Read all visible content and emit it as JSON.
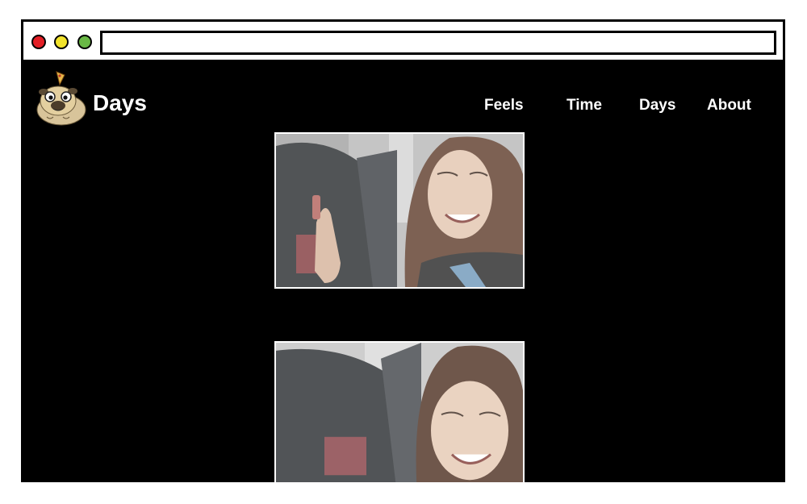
{
  "browser": {
    "url": "",
    "window_controls": [
      "close",
      "minimize",
      "maximize"
    ],
    "colors": {
      "close": "#e21f26",
      "minimize": "#f2e32c",
      "maximize": "#69b845"
    }
  },
  "site": {
    "brand": "Days",
    "logo_icon": "pug-with-pizza-icon",
    "nav": [
      {
        "label": "Feels"
      },
      {
        "label": "Time"
      },
      {
        "label": "Days"
      },
      {
        "label": "About"
      }
    ]
  },
  "content": {
    "photos": [
      {
        "subject": "photo-smiling-in-car"
      },
      {
        "subject": "photo-laughing-in-car"
      }
    ]
  },
  "colors": {
    "background": "#000000",
    "text": "#ffffff"
  }
}
